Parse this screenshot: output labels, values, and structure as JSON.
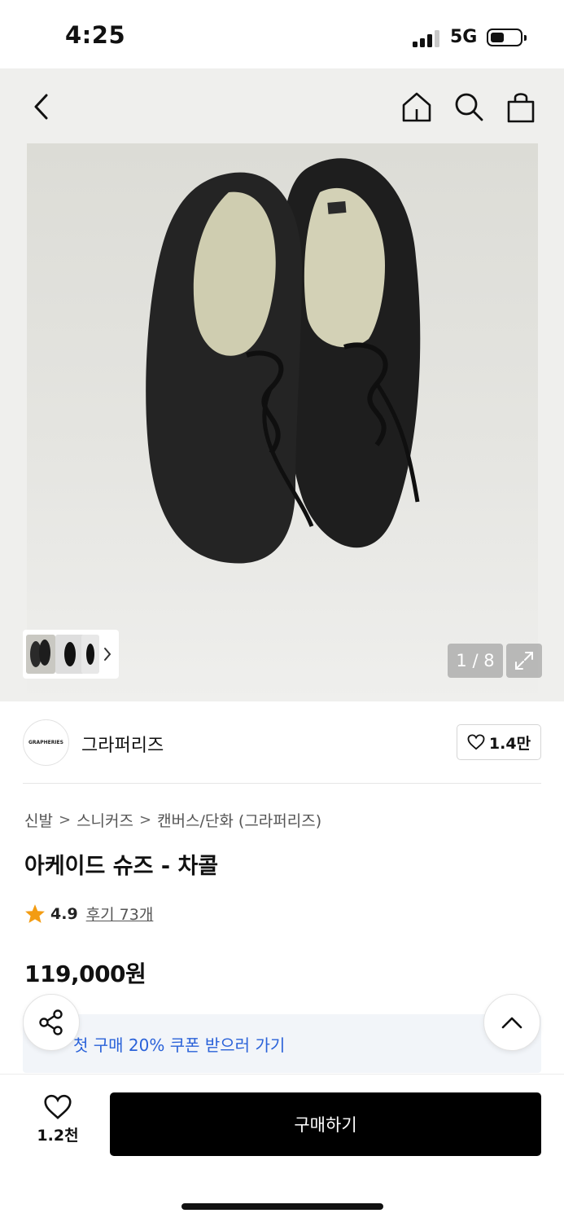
{
  "status_bar": {
    "time": "4:25",
    "network": "5G"
  },
  "header": {
    "icons": [
      "back-icon",
      "home-icon",
      "search-icon",
      "shopping-bag-icon"
    ]
  },
  "gallery": {
    "counter": "1 / 8",
    "current_index": 1,
    "total": 8
  },
  "brand": {
    "logo_text": "GRAPHERIES",
    "name": "그라퍼리즈",
    "likes": "1.4만"
  },
  "breadcrumb": {
    "level1": "신발",
    "level2": "스니커즈",
    "level3": "캔버스/단화 (그라퍼리즈)",
    "separator": ">"
  },
  "product": {
    "title": "아케이드 슈즈 - 차콜",
    "rating": "4.9",
    "reviews": "후기 73개",
    "price": "119,000원"
  },
  "coupon": {
    "text": "첫 구매 20% 쿠폰 받으러 가기",
    "color": "#2a62d9"
  },
  "bottom_bar": {
    "wish_count": "1.2천",
    "buy_label": "구매하기"
  },
  "colors": {
    "accent_star": "#f39c12",
    "buy_button": "#000000",
    "coupon_bg": "#f2f5f9"
  }
}
